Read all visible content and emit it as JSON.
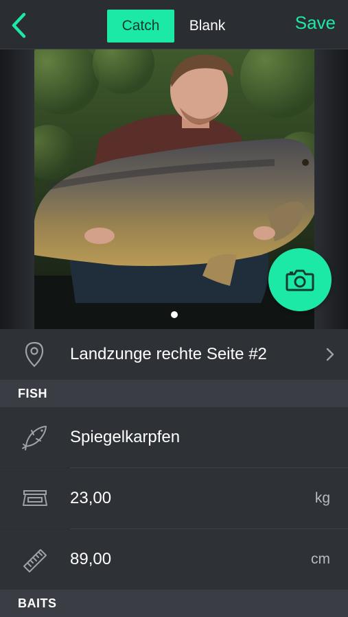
{
  "nav": {
    "tabs": [
      {
        "label": "Catch",
        "active": true
      },
      {
        "label": "Blank",
        "active": false
      }
    ],
    "save_label": "Save",
    "back_icon": "chevron-left-icon"
  },
  "photo": {
    "page_count": 1,
    "current_page": 1,
    "camera_icon": "camera-icon"
  },
  "location": {
    "icon": "map-pin-icon",
    "text": "Landzunge rechte Seite #2",
    "chevron_icon": "chevron-right-icon"
  },
  "fish_section": {
    "title": "FISH",
    "species": {
      "icon": "fish-icon",
      "value": "Spiegelkarpfen"
    },
    "weight": {
      "icon": "scale-icon",
      "value": "23,00",
      "unit": "kg"
    },
    "length": {
      "icon": "ruler-icon",
      "value": "89,00",
      "unit": "cm"
    }
  },
  "baits_section": {
    "title": "BAITS"
  },
  "colors": {
    "accent": "#1de9a6",
    "background": "#2e3136",
    "section_header": "#3a3e44"
  }
}
